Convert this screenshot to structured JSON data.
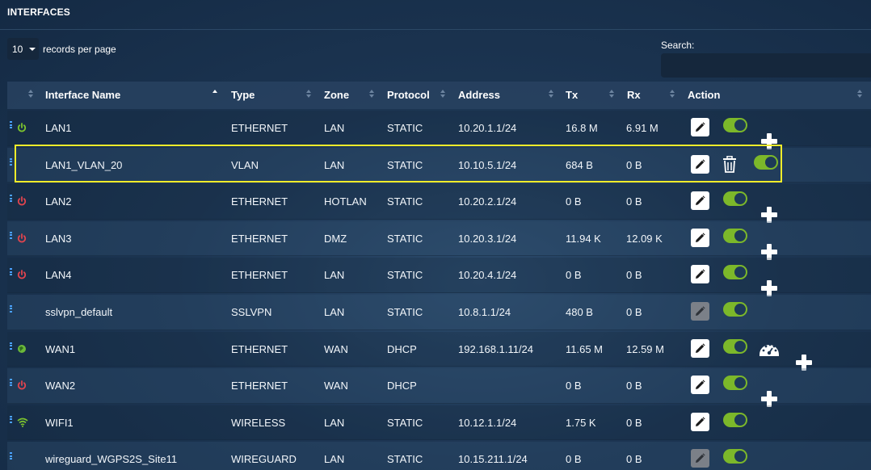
{
  "page": {
    "title": "INTERFACES"
  },
  "controls": {
    "per_page_value": "10",
    "per_page_label": "records per page",
    "search_label": "Search:",
    "search_value": ""
  },
  "table": {
    "headers": {
      "name": "Interface Name",
      "type": "Type",
      "zone": "Zone",
      "protocol": "Protocol",
      "address": "Address",
      "tx": "Tx",
      "rx": "Rx",
      "action": "Action"
    },
    "rows": [
      {
        "name": "LAN1",
        "type": "ETHERNET",
        "zone": "LAN",
        "protocol": "STATIC",
        "address": "10.20.1.1/24",
        "tx": "16.8 M",
        "rx": "6.91 M",
        "status_icon": "power-green-icon"
      },
      {
        "name": "LAN1_VLAN_20",
        "type": "VLAN",
        "zone": "LAN",
        "protocol": "STATIC",
        "address": "10.10.5.1/24",
        "tx": "684 B",
        "rx": "0 B",
        "status_icon": "none"
      },
      {
        "name": "LAN2",
        "type": "ETHERNET",
        "zone": "HOTLAN",
        "protocol": "STATIC",
        "address": "10.20.2.1/24",
        "tx": "0 B",
        "rx": "0 B",
        "status_icon": "power-red-icon"
      },
      {
        "name": "LAN3",
        "type": "ETHERNET",
        "zone": "DMZ",
        "protocol": "STATIC",
        "address": "10.20.3.1/24",
        "tx": "11.94 K",
        "rx": "12.09 K",
        "status_icon": "power-red-icon"
      },
      {
        "name": "LAN4",
        "type": "ETHERNET",
        "zone": "LAN",
        "protocol": "STATIC",
        "address": "10.20.4.1/24",
        "tx": "0 B",
        "rx": "0 B",
        "status_icon": "power-red-icon"
      },
      {
        "name": "sslvpn_default",
        "type": "SSLVPN",
        "zone": "LAN",
        "protocol": "STATIC",
        "address": "10.8.1.1/24",
        "tx": "480 B",
        "rx": "0 B",
        "status_icon": "none"
      },
      {
        "name": "WAN1",
        "type": "ETHERNET",
        "zone": "WAN",
        "protocol": "DHCP",
        "address": "192.168.1.11/24",
        "tx": "11.65 M",
        "rx": "12.59 M",
        "status_icon": "globe-green-icon"
      },
      {
        "name": "WAN2",
        "type": "ETHERNET",
        "zone": "WAN",
        "protocol": "DHCP",
        "address": "",
        "tx": "0 B",
        "rx": "0 B",
        "status_icon": "power-red-icon"
      },
      {
        "name": "WIFI1",
        "type": "WIRELESS",
        "zone": "LAN",
        "protocol": "STATIC",
        "address": "10.12.1.1/24",
        "tx": "1.75 K",
        "rx": "0 B",
        "status_icon": "wifi-green-icon"
      },
      {
        "name": "wireguard_WGPS2S_Site11",
        "type": "WIREGUARD",
        "zone": "LAN",
        "protocol": "STATIC",
        "address": "10.15.211.1/24",
        "tx": "0 B",
        "rx": "0 B",
        "status_icon": "none"
      }
    ]
  },
  "colors": {
    "toggle_on": "#7cb82a",
    "highlight": "#f2ec2a",
    "power_on": "#7cc42e",
    "power_off": "#e0444e",
    "handle": "#4aa2ff"
  }
}
